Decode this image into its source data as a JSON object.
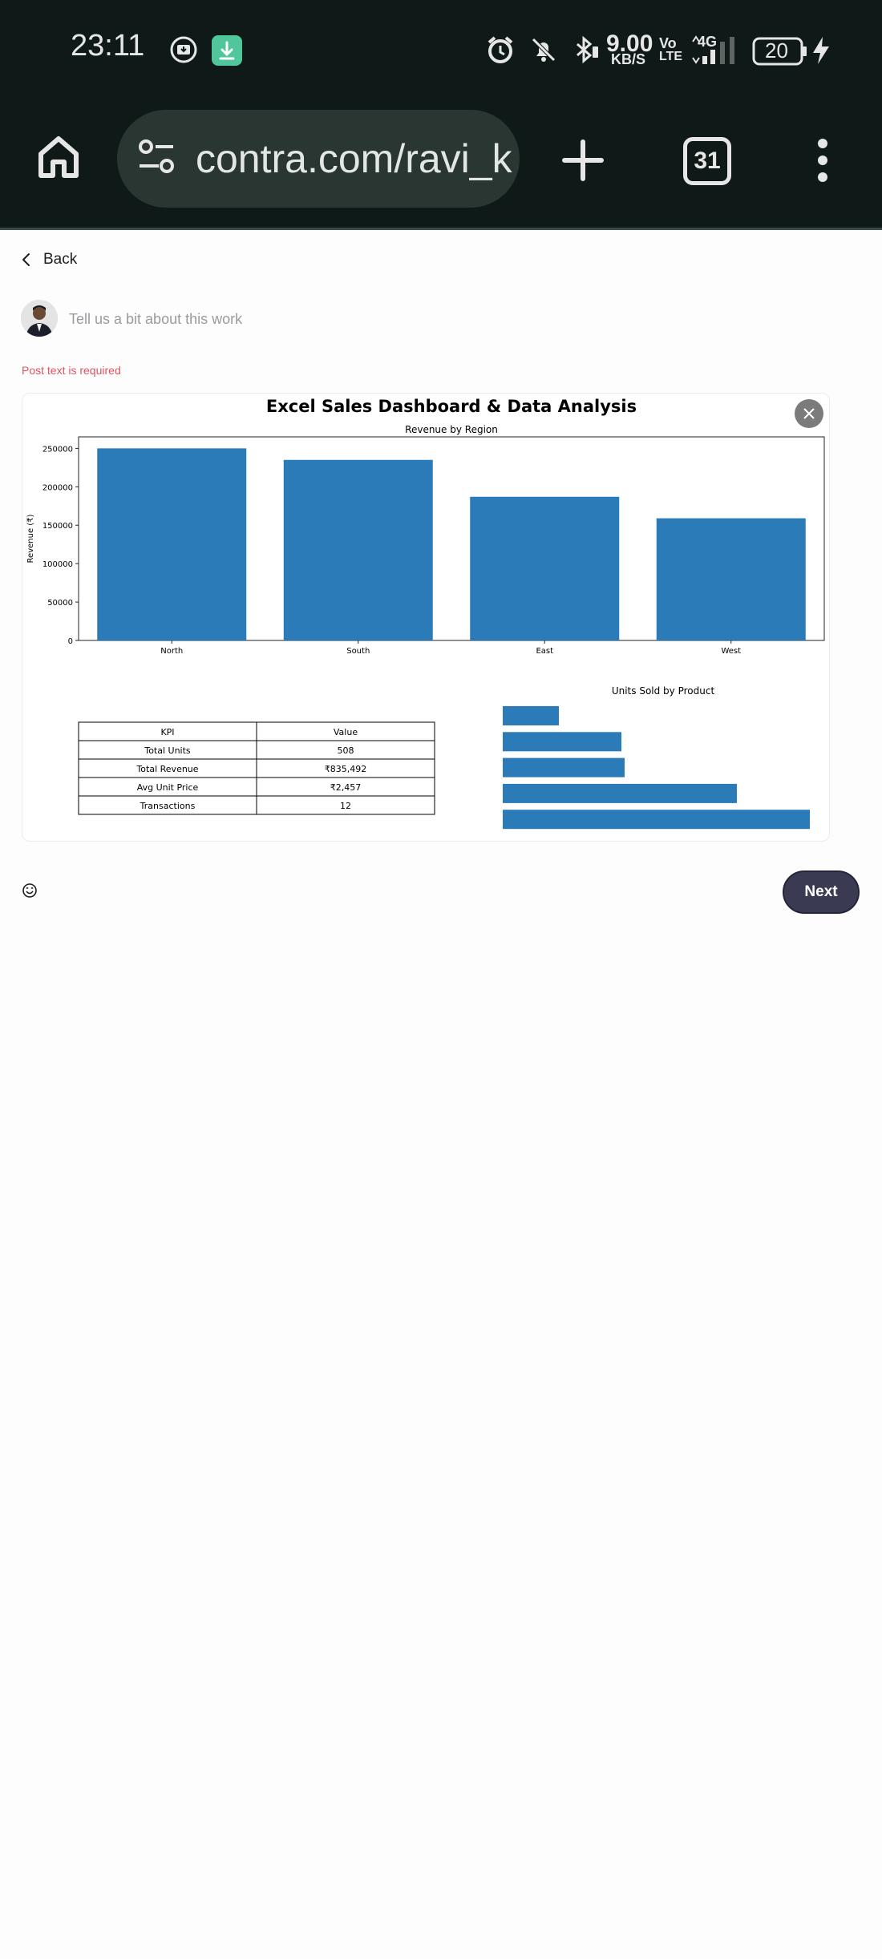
{
  "status_bar": {
    "time": "23:11",
    "network_speed_value": "9.00",
    "network_speed_unit": "KB/S",
    "volte_top": "Vo",
    "volte_bottom": "LTE",
    "network_type": "4G",
    "battery_level": "20",
    "icons": [
      "screen-record-icon",
      "download-app-icon",
      "alarm-icon",
      "bell-muted-icon",
      "bluetooth-icon",
      "signal-icon",
      "battery-icon",
      "charging-bolt-icon"
    ]
  },
  "browser": {
    "url": "contra.com/ravi_k",
    "tab_count": "31",
    "icons": [
      "home-icon",
      "site-settings-icon",
      "new-tab-plus-icon",
      "kebab-menu-icon"
    ]
  },
  "page": {
    "back_label": "Back",
    "post_placeholder": "Tell us a bit about this work",
    "post_value": "",
    "error_text": "Post text is required",
    "next_label": "Next",
    "accent_color": "#3a3a52",
    "error_color": "#e05262"
  },
  "chart_data": {
    "title": "Excel Sales Dashboard & Data Analysis",
    "bar_color": "#2b7bb9",
    "charts": [
      {
        "type": "bar",
        "title": "Revenue by Region",
        "ylabel": "Revenue (₹)",
        "xlabel": "",
        "categories": [
          "North",
          "South",
          "East",
          "West"
        ],
        "values": [
          250000,
          235000,
          187000,
          159000
        ],
        "ylim": [
          0,
          265000
        ],
        "yticks": [
          0,
          50000,
          100000,
          150000,
          200000,
          250000
        ],
        "grid": false
      },
      {
        "type": "table",
        "columns": [
          "KPI",
          "Value"
        ],
        "rows": [
          [
            "Total Units",
            "508"
          ],
          [
            "Total Revenue",
            "₹835,492"
          ],
          [
            "Avg Unit Price",
            "₹2,457"
          ],
          [
            "Transactions",
            "12"
          ]
        ]
      },
      {
        "type": "bar",
        "orientation": "horizontal",
        "title": "Units Sold by Product",
        "values": [
          70,
          148,
          152,
          292,
          383
        ],
        "xlim": [
          0,
          383
        ]
      }
    ]
  }
}
